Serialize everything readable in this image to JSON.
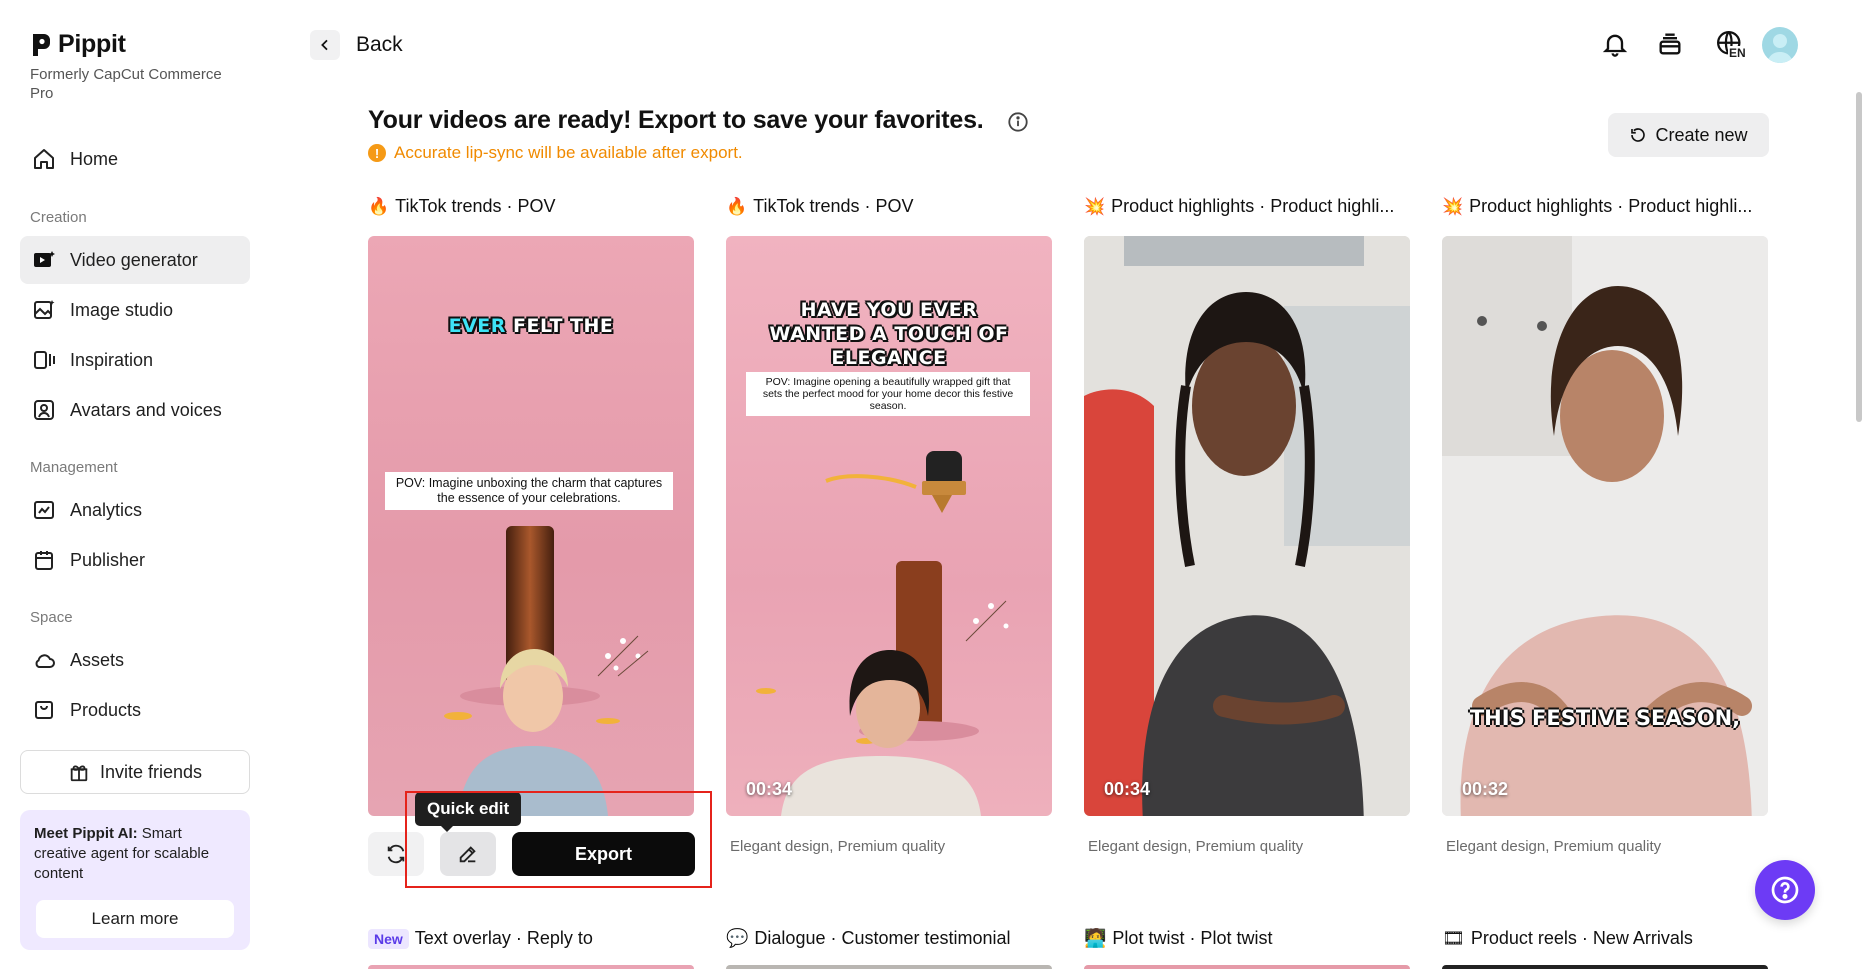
{
  "brand": {
    "name": "Pippit",
    "subtitle": "Formerly CapCut Commerce Pro"
  },
  "sidebar": {
    "home": "Home",
    "sections": {
      "creation": "Creation",
      "management": "Management",
      "space": "Space"
    },
    "creation_items": [
      "Video generator",
      "Image studio",
      "Inspiration",
      "Avatars and voices"
    ],
    "management_items": [
      "Analytics",
      "Publisher"
    ],
    "space_items": [
      "Assets",
      "Products"
    ],
    "invite": "Invite friends",
    "ai_card": {
      "bold": "Meet Pippit AI:",
      "text": " Smart creative agent for scalable content",
      "button": "Learn more"
    }
  },
  "header": {
    "back": "Back",
    "lang": "EN"
  },
  "main": {
    "title": "Your videos are ready! Export to save your favorites.",
    "warning": "Accurate lip-sync will be available after export.",
    "create_new": "Create new"
  },
  "cards": [
    {
      "emoji": "🔥",
      "title": "TikTok trends · POV",
      "overlay_headline_a": "EVER",
      "overlay_headline_b": " FELT THE",
      "overlay_box": "POV: Imagine unboxing the charm that captures the essence of your celebrations.",
      "actions": {
        "tooltip": "Quick edit",
        "export": "Export"
      }
    },
    {
      "emoji": "🔥",
      "title": "TikTok trends · POV",
      "overlay_headline": "HAVE YOU EVER WANTED A TOUCH OF ELEGANCE",
      "overlay_box": "POV: Imagine opening a beautifully wrapped gift that sets the perfect mood for your home decor this festive season.",
      "duration": "00:34",
      "caption": "Elegant design, Premium quality"
    },
    {
      "emoji": "💥",
      "title": "Product highlights · Product highli...",
      "duration": "00:34",
      "caption": "Elegant design, Premium quality"
    },
    {
      "emoji": "💥",
      "title": "Product highlights · Product highli...",
      "subtitle": "THIS FESTIVE SEASON,",
      "duration": "00:32",
      "caption": "Elegant design, Premium quality"
    }
  ],
  "row2": [
    {
      "badge": "New",
      "title": "Text overlay · Reply to"
    },
    {
      "icon": "💬",
      "title": "Dialogue · Customer testimonial"
    },
    {
      "icon": "🧑‍💻",
      "title": "Plot twist · Plot twist"
    },
    {
      "icon": "🎞",
      "title": "Product reels · New Arrivals"
    }
  ],
  "colors": {
    "accent": "#6d3bf5",
    "warning": "#f08a00",
    "highlight_box": "#e5231b"
  }
}
